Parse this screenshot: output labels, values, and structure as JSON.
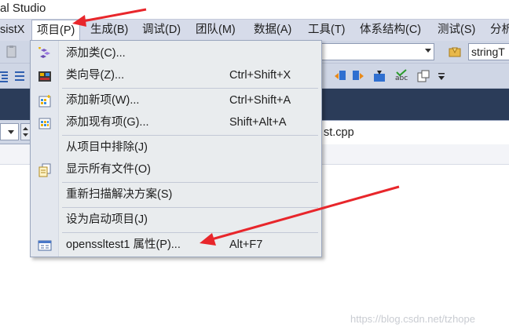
{
  "window": {
    "title": "al Studio"
  },
  "menubar": {
    "items": [
      {
        "label": "sistX"
      },
      {
        "label": "项目(P)",
        "active": true
      },
      {
        "label": "生成(B)"
      },
      {
        "label": "调试(D)"
      },
      {
        "label": "团队(M)"
      },
      {
        "label": "数据(A)"
      },
      {
        "label": "工具(T)"
      },
      {
        "label": "体系结构(C)"
      },
      {
        "label": "测试(S)"
      },
      {
        "label": "分析"
      }
    ]
  },
  "toolbar": {
    "search_combo_value": "stringT"
  },
  "editor": {
    "file_tab": "st.cpp"
  },
  "project_menu": {
    "items": [
      {
        "label": "添加类(C)...",
        "shortcut": "",
        "icon": "add-class-icon"
      },
      {
        "label": "类向导(Z)...",
        "shortcut": "Ctrl+Shift+X",
        "icon": "class-wizard-icon"
      },
      {
        "label": "添加新项(W)...",
        "shortcut": "Ctrl+Shift+A",
        "icon": "add-new-item-icon"
      },
      {
        "label": "添加现有项(G)...",
        "shortcut": "Shift+Alt+A",
        "icon": "add-existing-item-icon"
      },
      {
        "label": "从项目中排除(J)",
        "shortcut": "",
        "icon": ""
      },
      {
        "label": "显示所有文件(O)",
        "shortcut": "",
        "icon": "show-all-files-icon"
      },
      {
        "label": "重新扫描解决方案(S)",
        "shortcut": "",
        "icon": ""
      },
      {
        "label": "设为启动项目(J)",
        "shortcut": "",
        "icon": ""
      },
      {
        "label": "openssltest1 属性(P)...",
        "shortcut": "Alt+F7",
        "icon": "properties-icon"
      }
    ]
  },
  "watermark": "https://blog.csdn.net/tzhope",
  "colors": {
    "menubar_bg": "#d6dbe9",
    "dropdown_bg": "#e9ecee",
    "dark_band": "#2b3c59",
    "arrow_red": "#e8262b"
  }
}
